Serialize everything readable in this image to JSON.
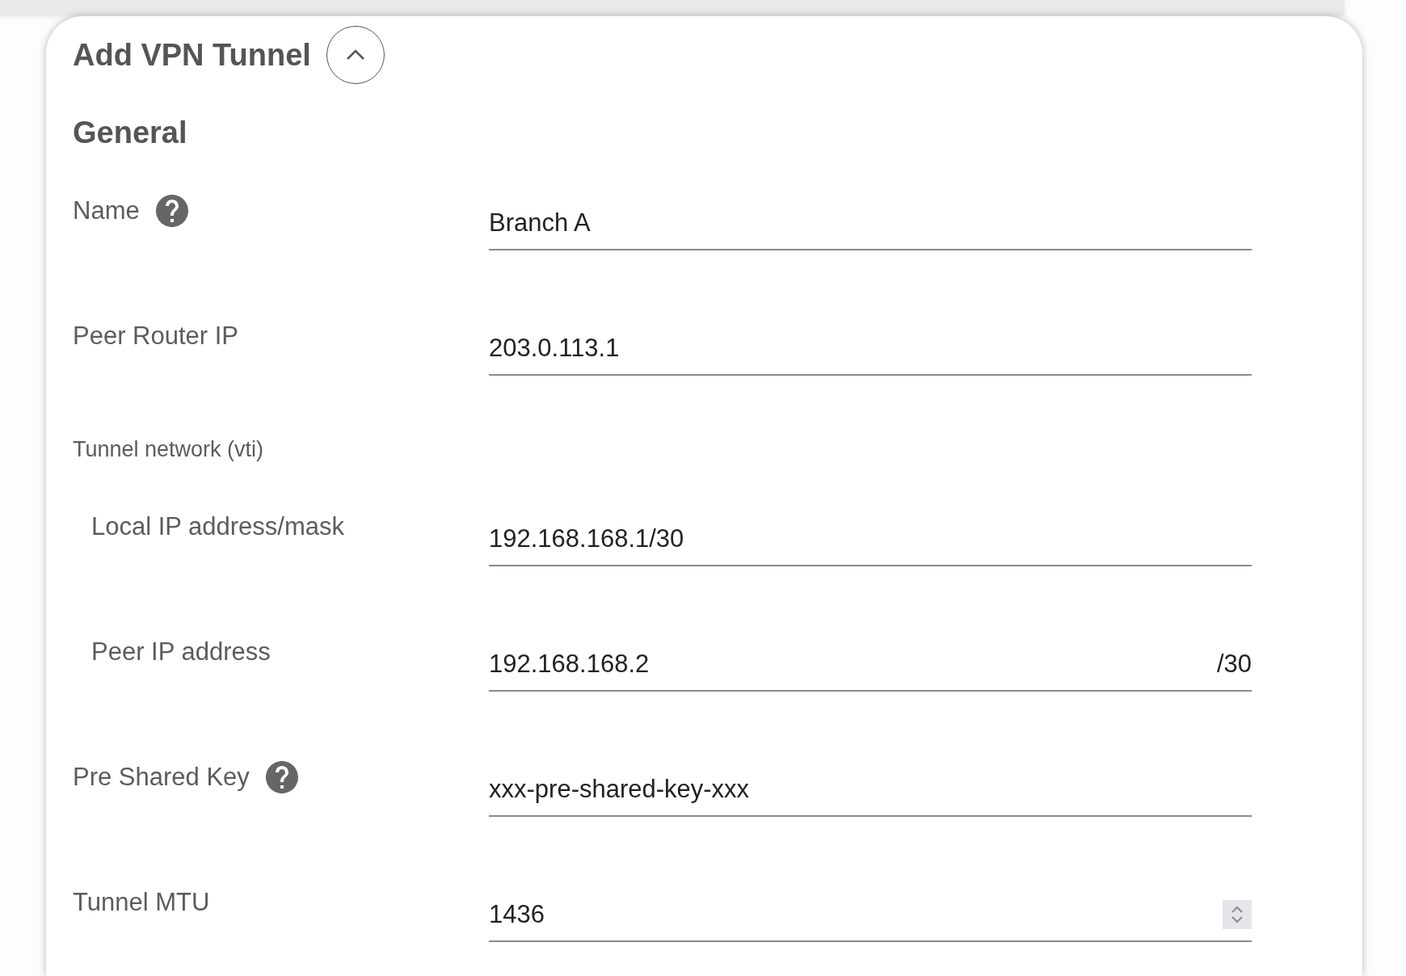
{
  "panel": {
    "title": "Add VPN Tunnel",
    "expanded": true
  },
  "section": {
    "title": "General"
  },
  "fields": [
    {
      "kind": "text",
      "label": "Name",
      "help": true,
      "value": "Branch A"
    },
    {
      "kind": "text",
      "label": "Peer Router IP",
      "help": false,
      "value": "203.0.113.1"
    },
    {
      "kind": "group",
      "label": "Tunnel network (vti)",
      "children": [
        {
          "kind": "text",
          "label": "Local IP address/mask",
          "help": false,
          "value": "192.168.168.1/30"
        },
        {
          "kind": "text",
          "label": "Peer IP address",
          "help": false,
          "value": "192.168.168.2",
          "suffix": "/30"
        }
      ]
    },
    {
      "kind": "text",
      "label": "Pre Shared Key",
      "help": true,
      "value": "xxx-pre-shared-key-xxx"
    },
    {
      "kind": "number",
      "label": "Tunnel MTU",
      "help": false,
      "value": "1436"
    }
  ]
}
